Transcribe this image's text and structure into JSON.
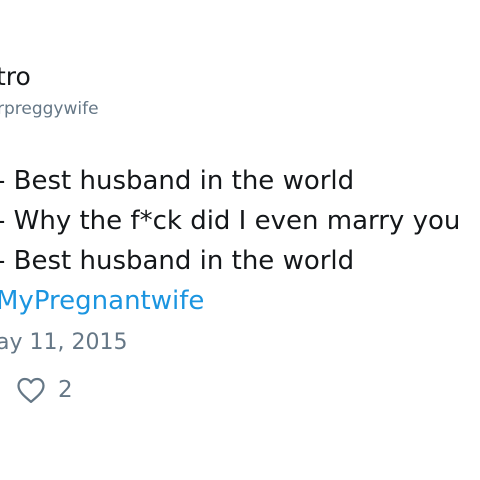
{
  "author": {
    "display_name": "tro",
    "handle": "rpreggywife"
  },
  "tweet": {
    "lines": [
      "- Best husband in the world",
      "- Why the f*ck did I even marry you",
      "- Best husband in the world"
    ],
    "hashtag": "MyPregnantwife",
    "timestamp": "ay 11, 2015"
  },
  "actions": {
    "like_icon": "heart-outline-icon",
    "like_count": "2"
  },
  "colors": {
    "text": "#14171a",
    "secondary": "#657786",
    "link": "#1b95e0"
  }
}
